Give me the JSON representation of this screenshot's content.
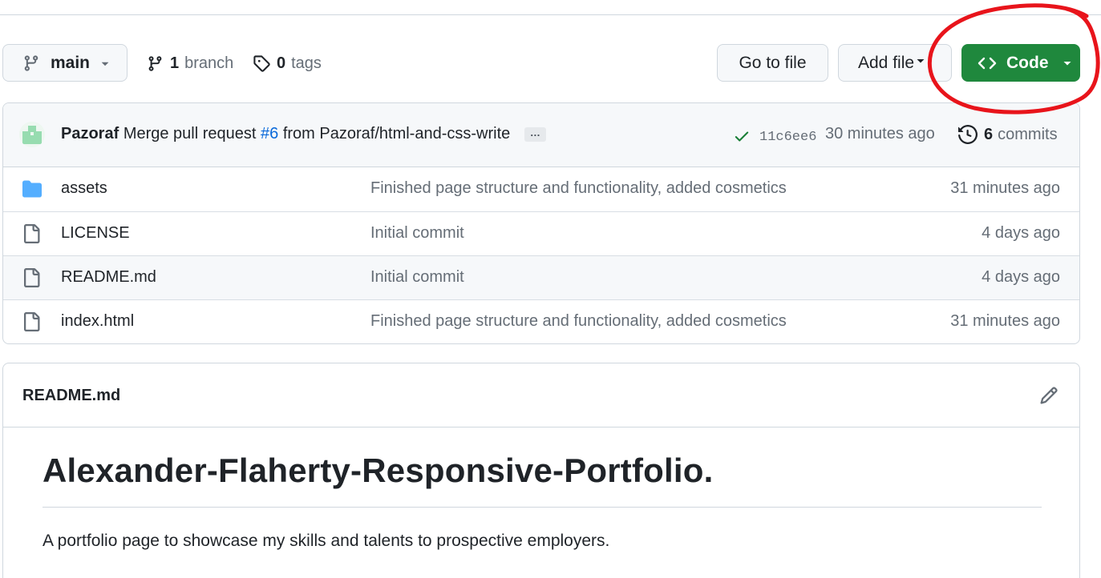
{
  "toolbar": {
    "branch_name": "main",
    "branch_count": "1",
    "branch_label": "branch",
    "tag_count": "0",
    "tag_label": "tags",
    "go_to_file_label": "Go to file",
    "add_file_label": "Add file",
    "code_label": "Code"
  },
  "colors": {
    "code_button": "#1f883d",
    "annotation_circle": "#e8141b",
    "folder_icon": "#54aeff",
    "link": "#0969da",
    "check": "#1a7f37"
  },
  "latest_commit": {
    "author": "Pazoraf",
    "message_before": "Merge pull request",
    "pr_number": "#6",
    "message_after": "from Pazoraf/html-and-css-write",
    "ellipsis": "…",
    "sha": "11c6ee6",
    "time": "30 minutes ago",
    "commit_count": "6",
    "commits_label": "commits"
  },
  "files": [
    {
      "icon": "folder-icon",
      "name": "assets",
      "message": "Finished page structure and functionality, added cosmetics",
      "age": "31 minutes ago"
    },
    {
      "icon": "file-icon",
      "name": "LICENSE",
      "message": "Initial commit",
      "age": "4 days ago"
    },
    {
      "icon": "file-icon",
      "name": "README.md",
      "message": "Initial commit",
      "age": "4 days ago"
    },
    {
      "icon": "file-icon",
      "name": "index.html",
      "message": "Finished page structure and functionality, added cosmetics",
      "age": "31 minutes ago"
    }
  ],
  "readme": {
    "file_name": "README.md",
    "heading": "Alexander-Flaherty-Responsive-Portfolio.",
    "paragraph": "A portfolio page to showcase my skills and talents to prospective employers."
  }
}
